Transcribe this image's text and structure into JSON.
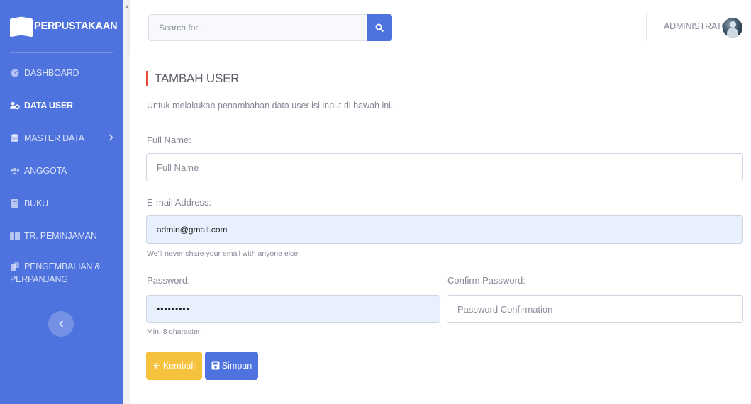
{
  "brand": {
    "name": "PERPUSTAKAAN"
  },
  "sidebar": {
    "items": [
      {
        "label": "DASHBOARD",
        "icon": "dashboard-icon"
      },
      {
        "label": "DATA USER",
        "icon": "users-icon",
        "active": true
      },
      {
        "label": "MASTER DATA",
        "icon": "database-icon"
      },
      {
        "label": "ANGGOTA",
        "icon": "members-icon"
      },
      {
        "label": "BUKU",
        "icon": "book-icon"
      },
      {
        "label": "TR. PEMINJAMAN",
        "icon": "loan-icon"
      },
      {
        "label_line1": "PENGEMBALIAN &",
        "label_line2": "PERPANJANG",
        "icon": "return-icon"
      }
    ],
    "toggle_icon": "chevron-left-icon"
  },
  "topbar": {
    "search_placeholder": "Search for...",
    "user_name": "ADMINISTRATOR"
  },
  "form": {
    "title": "TAMBAH USER",
    "subtitle": "Untuk melakukan penambahan data user isi input di bawah ini.",
    "full_name_label": "Full Name:",
    "full_name_placeholder": "Full Name",
    "email_label": "E-mail Address:",
    "email_value": "admin@gmail.com",
    "email_help": "We'll never share your email with anyone else.",
    "password_label": "Password:",
    "password_value": "•••••••••",
    "password_help": "Min. 8 character",
    "confirm_label": "Confirm Password:",
    "confirm_placeholder": "Password Confirmation",
    "back_label": "Kembali",
    "save_label": "Simpan"
  },
  "colors": {
    "primary": "#4e73df",
    "warning": "#f6c23e",
    "danger": "#e74a3b"
  }
}
